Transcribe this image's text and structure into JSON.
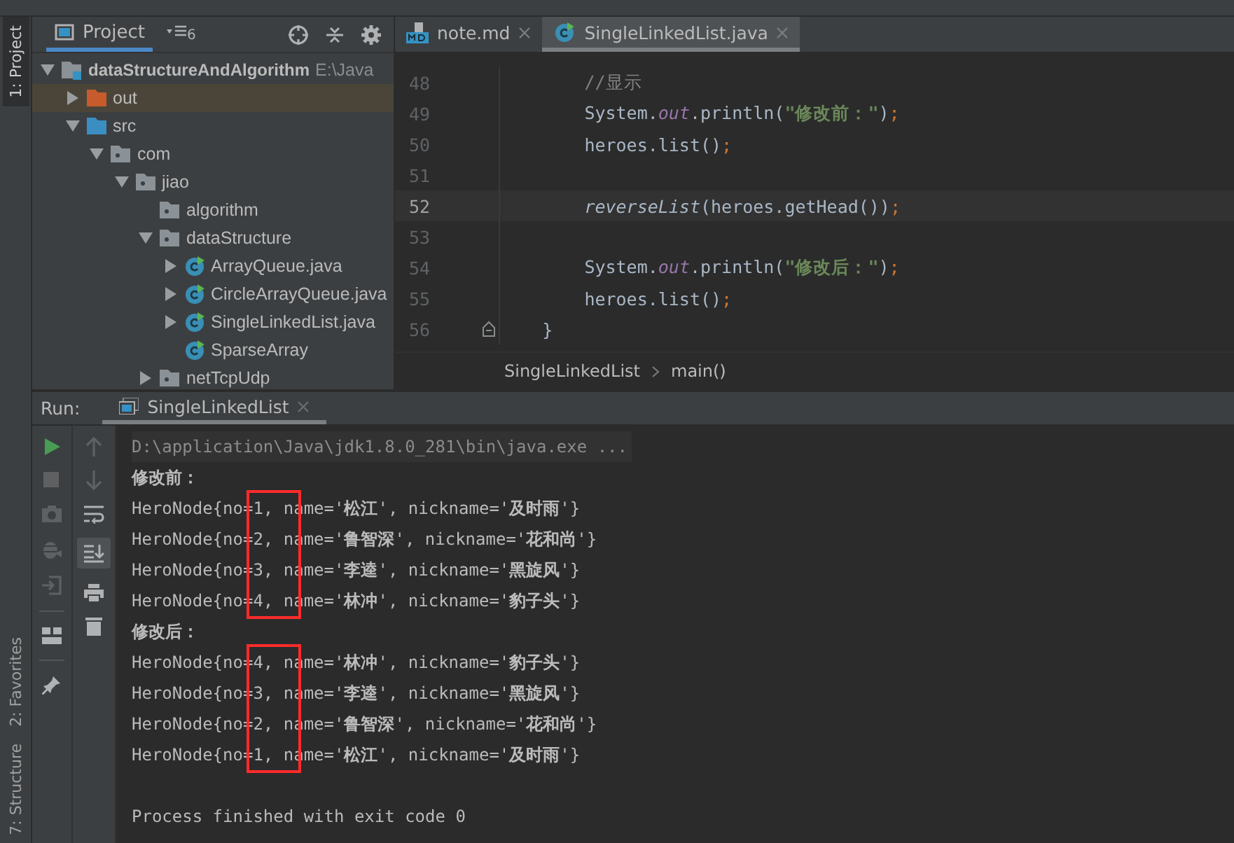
{
  "tool_stripe": [
    {
      "label": "1: Project",
      "selected": true
    },
    {
      "label": "2: Favorites",
      "selected": false
    },
    {
      "label": "7: Structure",
      "selected": false
    }
  ],
  "project_panel": {
    "title": "Project",
    "view_count": "6",
    "tree": [
      {
        "label": "dataStructureAndAlgorithm",
        "path": "E:\\Java",
        "kind": "module",
        "expanded": true,
        "selected": false,
        "children": [
          {
            "label": "out",
            "kind": "excluded-folder",
            "expanded": false,
            "selected": true
          },
          {
            "label": "src",
            "kind": "source-folder",
            "expanded": true,
            "selected": false,
            "children": [
              {
                "label": "com",
                "kind": "package",
                "expanded": true,
                "selected": false,
                "children": [
                  {
                    "label": "jiao",
                    "kind": "package",
                    "expanded": true,
                    "selected": false,
                    "children": [
                      {
                        "label": "algorithm",
                        "kind": "package",
                        "selected": false
                      },
                      {
                        "label": "dataStructure",
                        "kind": "package",
                        "expanded": true,
                        "selected": false,
                        "children": [
                          {
                            "label": "ArrayQueue.java",
                            "kind": "class",
                            "expanded": false,
                            "selected": false
                          },
                          {
                            "label": "CircleArrayQueue.java",
                            "kind": "class",
                            "expanded": false,
                            "selected": false
                          },
                          {
                            "label": "SingleLinkedList.java",
                            "kind": "class",
                            "expanded": false,
                            "selected": false
                          },
                          {
                            "label": "SparseArray",
                            "kind": "class",
                            "selected": false
                          }
                        ]
                      },
                      {
                        "label": "netTcpUdp",
                        "kind": "package",
                        "expanded": false,
                        "selected": false
                      }
                    ]
                  }
                ]
              }
            ]
          }
        ]
      }
    ]
  },
  "editor": {
    "tabs": [
      {
        "label": "note.md",
        "kind": "markdown",
        "selected": false
      },
      {
        "label": "SingleLinkedList.java",
        "kind": "java",
        "selected": true
      }
    ],
    "lines": [
      {
        "number": "48",
        "current": false,
        "fold": false,
        "segments": [
          {
            "kind": "comment",
            "text": "        //显示"
          }
        ]
      },
      {
        "number": "49",
        "current": false,
        "fold": false,
        "segments": [
          {
            "kind": "plain",
            "text": "        System."
          },
          {
            "kind": "field",
            "text": "out"
          },
          {
            "kind": "plain",
            "text": ".println("
          },
          {
            "kind": "string",
            "text": "\"修改前：\""
          },
          {
            "kind": "plain",
            "text": ")"
          },
          {
            "kind": "punct",
            "text": ";"
          }
        ]
      },
      {
        "number": "50",
        "current": false,
        "fold": false,
        "segments": [
          {
            "kind": "plain",
            "text": "        heroes.list()"
          },
          {
            "kind": "punct",
            "text": ";"
          }
        ]
      },
      {
        "number": "51",
        "current": false,
        "fold": false
      },
      {
        "number": "52",
        "current": true,
        "fold": false,
        "segments": [
          {
            "kind": "static-call",
            "text": "        reverseList"
          },
          {
            "kind": "plain",
            "text": "(heroes.getHead())"
          },
          {
            "kind": "punct",
            "text": ";"
          }
        ]
      },
      {
        "number": "53",
        "current": false,
        "fold": false
      },
      {
        "number": "54",
        "current": false,
        "fold": false,
        "segments": [
          {
            "kind": "plain",
            "text": "        System."
          },
          {
            "kind": "field",
            "text": "out"
          },
          {
            "kind": "plain",
            "text": ".println("
          },
          {
            "kind": "string",
            "text": "\"修改后：\""
          },
          {
            "kind": "plain",
            "text": ")"
          },
          {
            "kind": "punct",
            "text": ";"
          }
        ]
      },
      {
        "number": "55",
        "current": false,
        "fold": false,
        "segments": [
          {
            "kind": "plain",
            "text": "        heroes.list()"
          },
          {
            "kind": "punct",
            "text": ";"
          }
        ]
      },
      {
        "number": "56",
        "current": false,
        "fold": true,
        "segments": [
          {
            "kind": "plain",
            "text": "    }"
          }
        ]
      }
    ],
    "breadcrumbs": [
      "SingleLinkedList",
      "main()"
    ]
  },
  "run_panel": {
    "title": "Run:",
    "tab": "SingleLinkedList",
    "console": [
      {
        "kind": "command",
        "text": "D:\\application\\Java\\jdk1.8.0_281\\bin\\java.exe ...",
        "boxed": false
      },
      {
        "kind": "heading",
        "text": "修改前：",
        "boxed": false
      },
      {
        "kind": "output",
        "text": "HeroNode{no=1, name='**松江**', nickname='**及时雨**'}",
        "boxed": true
      },
      {
        "kind": "output",
        "text": "HeroNode{no=2, name='**鲁智深**', nickname='**花和尚**'}",
        "boxed": true
      },
      {
        "kind": "output",
        "text": "HeroNode{no=3, name='**李逵**', nickname='**黑旋风**'}",
        "boxed": true
      },
      {
        "kind": "output",
        "text": "HeroNode{no=4, name='**林冲**', nickname='**豹子头**'}",
        "boxed": true
      },
      {
        "kind": "heading",
        "text": "修改后：",
        "boxed": false
      },
      {
        "kind": "output",
        "text": "HeroNode{no=4, name='**林冲**', nickname='**豹子头**'}",
        "boxed": true
      },
      {
        "kind": "output",
        "text": "HeroNode{no=3, name='**李逵**', nickname='**黑旋风**'}",
        "boxed": true
      },
      {
        "kind": "output",
        "text": "HeroNode{no=2, name='**鲁智深**', nickname='**花和尚**'}",
        "boxed": true
      },
      {
        "kind": "output",
        "text": "HeroNode{no=1, name='**松江**', nickname='**及时雨**'}",
        "boxed": true
      },
      {
        "kind": "summary",
        "text": "Process finished with exit code 0",
        "boxed": false
      }
    ]
  }
}
